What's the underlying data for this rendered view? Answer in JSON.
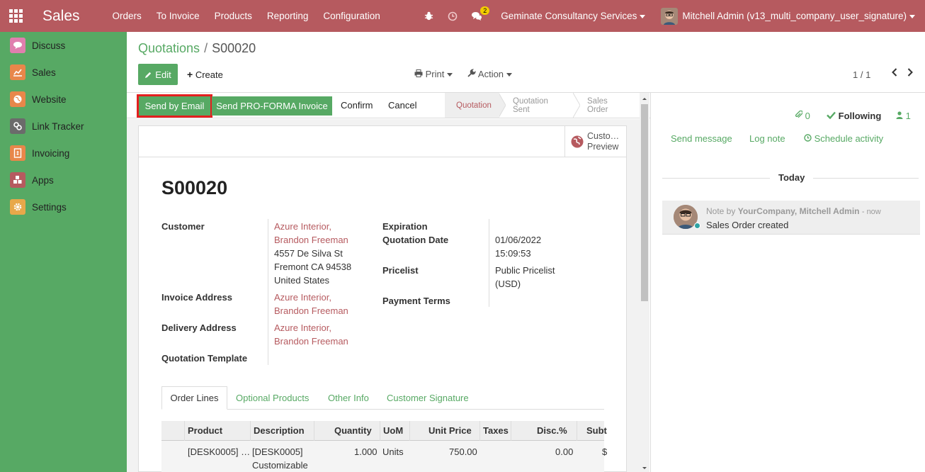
{
  "app": {
    "title": "Sales"
  },
  "topmenu": [
    "Orders",
    "To Invoice",
    "Products",
    "Reporting",
    "Configuration"
  ],
  "topbar": {
    "chat_count": "2",
    "company": "Geminate Consultancy Services",
    "user": "Mitchell Admin (v13_multi_company_user_signature)"
  },
  "sidebar": {
    "items": [
      {
        "label": "Discuss",
        "color": "#e07fae"
      },
      {
        "label": "Sales",
        "color": "#e8874a"
      },
      {
        "label": "Website",
        "color": "#e8874a"
      },
      {
        "label": "Link Tracker",
        "color": "#6b6b6b"
      },
      {
        "label": "Invoicing",
        "color": "#e8874a"
      },
      {
        "label": "Apps",
        "color": "#b65a5f"
      },
      {
        "label": "Settings",
        "color": "#e8a84a"
      }
    ]
  },
  "breadcrumb": {
    "parent": "Quotations",
    "sep": "/",
    "current": "S00020"
  },
  "controls": {
    "edit": "Edit",
    "create": "Create",
    "print": "Print",
    "action": "Action",
    "pager": "1 / 1"
  },
  "statusbar": {
    "send_email": "Send by Email",
    "proforma": "Send PRO-FORMA Invoice",
    "confirm": "Confirm",
    "cancel": "Cancel",
    "stages": [
      "Quotation",
      "Quotation Sent",
      "Sales Order"
    ]
  },
  "preview": {
    "line1": "Custo…",
    "line2": "Preview"
  },
  "form": {
    "title": "S00020",
    "customer_label": "Customer",
    "customer_lines": [
      "Azure Interior,",
      "Brandon Freeman"
    ],
    "address_lines": [
      "4557 De Silva St",
      "Fremont CA 94538",
      "United States"
    ],
    "invoice_label": "Invoice Address",
    "invoice_lines": [
      "Azure Interior,",
      "Brandon Freeman"
    ],
    "delivery_label": "Delivery Address",
    "delivery_lines": [
      "Azure Interior,",
      "Brandon Freeman"
    ],
    "template_label": "Quotation Template",
    "expiration_label": "Expiration",
    "quotation_date_label": "Quotation Date",
    "quotation_date": [
      "01/06/2022",
      "15:09:53"
    ],
    "pricelist_label": "Pricelist",
    "pricelist": [
      "Public Pricelist",
      "(USD)"
    ],
    "payment_terms_label": "Payment Terms"
  },
  "tabs": [
    "Order Lines",
    "Optional Products",
    "Other Info",
    "Customer Signature"
  ],
  "table": {
    "headers": [
      "Product",
      "Description",
      "Quantity",
      "UoM",
      "Unit Price",
      "Taxes",
      "Disc.%",
      "Subt"
    ],
    "row": {
      "product": "[DESK0005] …",
      "description": [
        "[DESK0005]",
        "Customizable"
      ],
      "quantity": "1.000",
      "uom": "Units",
      "unit_price": "750.00",
      "discount": "0.00",
      "subtotal": "$"
    }
  },
  "chatter": {
    "attachments": "0",
    "following": "Following",
    "followers": "1",
    "send_message": "Send message",
    "log_note": "Log note",
    "schedule": "Schedule activity",
    "today": "Today",
    "msg_prefix": "Note by",
    "msg_author": "YourCompany, Mitchell Admin",
    "msg_time": "- now",
    "msg_body": "Sales Order created"
  }
}
